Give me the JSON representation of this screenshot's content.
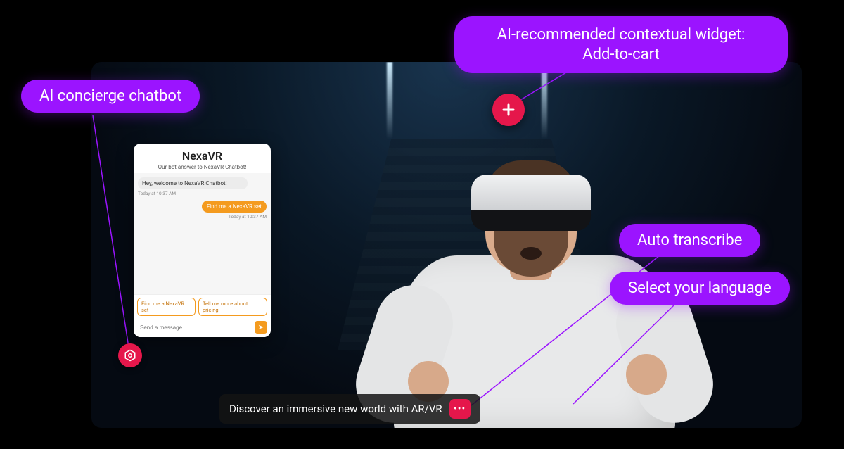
{
  "callouts": {
    "chatbot": "AI concierge chatbot",
    "widget_line1": "AI-recommended contextual widget:",
    "widget_line2": "Add-to-cart",
    "transcribe": "Auto transcribe",
    "language": "Select your language"
  },
  "chatbot": {
    "title": "NexaVR",
    "subtitle": "Our bot answer to NexaVR Chatbot!",
    "greeting": "Hey, welcome to NexaVR Chatbot!",
    "greeting_ts": "Today at 10:37 AM",
    "user_msg": "Find me a NexaVR set",
    "user_msg_ts": "Today at 10:37 AM",
    "suggestion1": "Find me a NexaVR set",
    "suggestion2": "Tell me more about pricing",
    "input_placeholder": "Send a message..."
  },
  "caption": {
    "text": "Discover an immersive new world with AR/VR"
  },
  "colors": {
    "purple": "#9b14ff",
    "crimson": "#e5174b",
    "orange": "#f49b1f"
  }
}
